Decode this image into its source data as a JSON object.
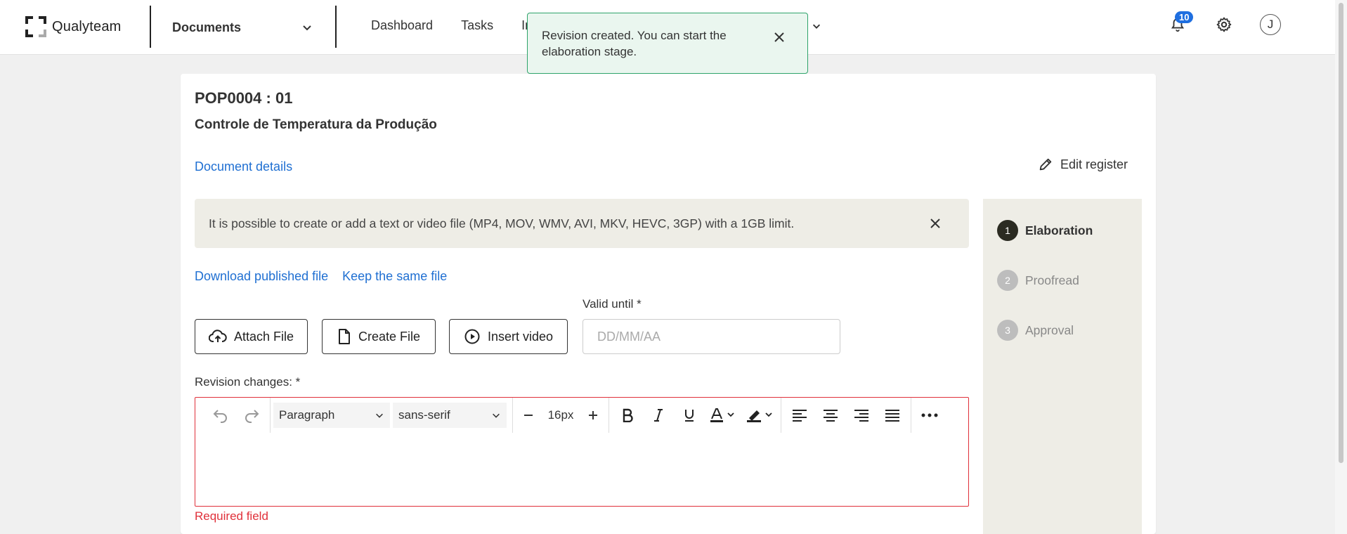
{
  "app": {
    "name": "Qualyteam"
  },
  "header": {
    "module": "Documents",
    "nav": [
      "Dashboard",
      "Tasks",
      "In"
    ],
    "nav_more": "h",
    "notifications_count": "10",
    "avatar_initial": "J"
  },
  "toast": {
    "message": "Revision created. You can start the elaboration stage."
  },
  "document": {
    "code": "POP0004 : 01",
    "title": "Controle de Temperatura da Produção",
    "details_link": "Document details",
    "edit_register": "Edit register"
  },
  "info_banner": {
    "text": "It is possible to create or add a text or video file (MP4, MOV, WMV, AVI, MKV, HEVC, 3GP) with a 1GB limit."
  },
  "file_links": {
    "download": "Download published file",
    "keep": "Keep the same file"
  },
  "buttons": {
    "attach": "Attach File",
    "create": "Create File",
    "video": "Insert video"
  },
  "valid_until": {
    "label": "Valid until *",
    "placeholder": "DD/MM/AA"
  },
  "revision": {
    "label": "Revision changes: *",
    "paragraph": "Paragraph",
    "font": "sans-serif",
    "font_size": "16px",
    "error": "Required field"
  },
  "steps": [
    {
      "num": "1",
      "label": "Elaboration",
      "state": "active"
    },
    {
      "num": "2",
      "label": "Proofread",
      "state": "inactive"
    },
    {
      "num": "3",
      "label": "Approval",
      "state": "inactive"
    }
  ],
  "colors": {
    "link": "#1f6fd2",
    "error": "#e0303a",
    "toast_border": "#2ea36a",
    "badge": "#1f6fe0"
  }
}
